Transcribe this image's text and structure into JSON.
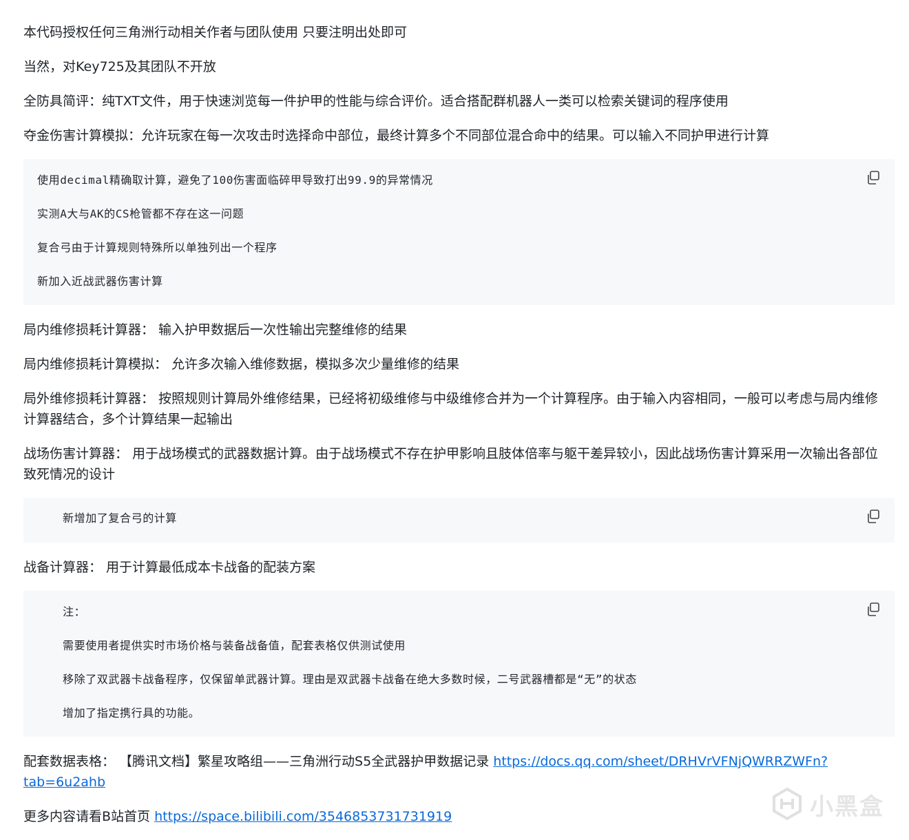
{
  "paragraphs": {
    "p1": "本代码授权任何三角洲行动相关作者与团队使用 只要注明出处即可",
    "p2": "当然，对Key725及其团队不开放",
    "p3": "全防具简评：纯TXT文件，用于快速浏览每一件护甲的性能与综合评价。适合搭配群机器人一类可以检索关键词的程序使用",
    "p4": "夺金伤害计算模拟：允许玩家在每一次攻击时选择命中部位，最终计算多个不同部位混合命中的结果。可以输入不同护甲进行计算",
    "p5": "局内维修损耗计算器： 输入护甲数据后一次性输出完整维修的结果",
    "p6": "局内维修损耗计算模拟： 允许多次输入维修数据，模拟多次少量维修的结果",
    "p7": "局外维修损耗计算器： 按照规则计算局外维修结果，已经将初级维修与中级维修合并为一个计算程序。由于输入内容相同，一般可以考虑与局内维修计算器结合，多个计算结果一起输出",
    "p8": "战场伤害计算器： 用于战场模式的武器数据计算。由于战场模式不存在护甲影响且肢体倍率与躯干差异较小，因此战场伤害计算采用一次输出各部位致死情况的设计",
    "p9": "战备计算器： 用于计算最低成本卡战备的配装方案",
    "p10_prefix": "配套数据表格： 【腾讯文档】繁星攻略组——三角洲行动S5全武器护甲数据记录 ",
    "p10_link": "https://docs.qq.com/sheet/DRHVrVFNjQWRRZWFn?tab=6u2ahb",
    "p11_prefix": "更多内容请看B站首页 ",
    "p11_link": "https://space.bilibili.com/3546853731731919"
  },
  "code_blocks": {
    "block1": {
      "lines": [
        "使用decimal精确取计算，避免了100伤害面临碎甲导致打出99.9的异常情况",
        "实测A大与AK的CS枪管都不存在这一问题",
        "复合弓由于计算规则特殊所以单独列出一个程序",
        "新加入近战武器伤害计算"
      ]
    },
    "block2": {
      "lines": [
        "新增加了复合弓的计算"
      ]
    },
    "block3": {
      "lines": [
        "注：",
        "需要使用者提供实时市场价格与装备战备值，配套表格仅供测试使用",
        "移除了双武器卡战备程序，仅保留单武器计算。理由是双武器卡战备在绝大多数时候，二号武器槽都是“无”的状态",
        "增加了指定携行具的功能。"
      ]
    }
  },
  "watermark": {
    "text": "小黑盒",
    "icon": "heybox-logo-icon"
  },
  "colors": {
    "link": "#0969da",
    "code_bg": "#f6f8fa",
    "text": "#1f2328"
  }
}
